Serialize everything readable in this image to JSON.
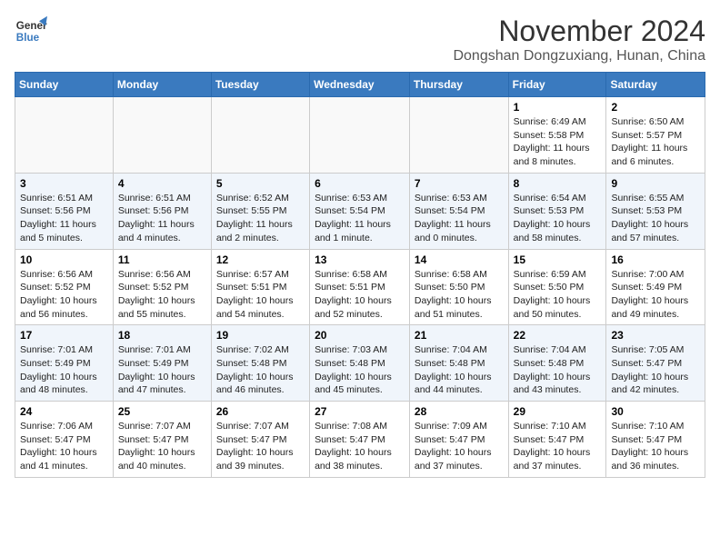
{
  "header": {
    "logo_line1": "General",
    "logo_line2": "Blue",
    "month": "November 2024",
    "location": "Dongshan Dongzuxiang, Hunan, China"
  },
  "weekdays": [
    "Sunday",
    "Monday",
    "Tuesday",
    "Wednesday",
    "Thursday",
    "Friday",
    "Saturday"
  ],
  "weeks": [
    [
      {
        "day": "",
        "info": ""
      },
      {
        "day": "",
        "info": ""
      },
      {
        "day": "",
        "info": ""
      },
      {
        "day": "",
        "info": ""
      },
      {
        "day": "",
        "info": ""
      },
      {
        "day": "1",
        "info": "Sunrise: 6:49 AM\nSunset: 5:58 PM\nDaylight: 11 hours and 8 minutes."
      },
      {
        "day": "2",
        "info": "Sunrise: 6:50 AM\nSunset: 5:57 PM\nDaylight: 11 hours and 6 minutes."
      }
    ],
    [
      {
        "day": "3",
        "info": "Sunrise: 6:51 AM\nSunset: 5:56 PM\nDaylight: 11 hours and 5 minutes."
      },
      {
        "day": "4",
        "info": "Sunrise: 6:51 AM\nSunset: 5:56 PM\nDaylight: 11 hours and 4 minutes."
      },
      {
        "day": "5",
        "info": "Sunrise: 6:52 AM\nSunset: 5:55 PM\nDaylight: 11 hours and 2 minutes."
      },
      {
        "day": "6",
        "info": "Sunrise: 6:53 AM\nSunset: 5:54 PM\nDaylight: 11 hours and 1 minute."
      },
      {
        "day": "7",
        "info": "Sunrise: 6:53 AM\nSunset: 5:54 PM\nDaylight: 11 hours and 0 minutes."
      },
      {
        "day": "8",
        "info": "Sunrise: 6:54 AM\nSunset: 5:53 PM\nDaylight: 10 hours and 58 minutes."
      },
      {
        "day": "9",
        "info": "Sunrise: 6:55 AM\nSunset: 5:53 PM\nDaylight: 10 hours and 57 minutes."
      }
    ],
    [
      {
        "day": "10",
        "info": "Sunrise: 6:56 AM\nSunset: 5:52 PM\nDaylight: 10 hours and 56 minutes."
      },
      {
        "day": "11",
        "info": "Sunrise: 6:56 AM\nSunset: 5:52 PM\nDaylight: 10 hours and 55 minutes."
      },
      {
        "day": "12",
        "info": "Sunrise: 6:57 AM\nSunset: 5:51 PM\nDaylight: 10 hours and 54 minutes."
      },
      {
        "day": "13",
        "info": "Sunrise: 6:58 AM\nSunset: 5:51 PM\nDaylight: 10 hours and 52 minutes."
      },
      {
        "day": "14",
        "info": "Sunrise: 6:58 AM\nSunset: 5:50 PM\nDaylight: 10 hours and 51 minutes."
      },
      {
        "day": "15",
        "info": "Sunrise: 6:59 AM\nSunset: 5:50 PM\nDaylight: 10 hours and 50 minutes."
      },
      {
        "day": "16",
        "info": "Sunrise: 7:00 AM\nSunset: 5:49 PM\nDaylight: 10 hours and 49 minutes."
      }
    ],
    [
      {
        "day": "17",
        "info": "Sunrise: 7:01 AM\nSunset: 5:49 PM\nDaylight: 10 hours and 48 minutes."
      },
      {
        "day": "18",
        "info": "Sunrise: 7:01 AM\nSunset: 5:49 PM\nDaylight: 10 hours and 47 minutes."
      },
      {
        "day": "19",
        "info": "Sunrise: 7:02 AM\nSunset: 5:48 PM\nDaylight: 10 hours and 46 minutes."
      },
      {
        "day": "20",
        "info": "Sunrise: 7:03 AM\nSunset: 5:48 PM\nDaylight: 10 hours and 45 minutes."
      },
      {
        "day": "21",
        "info": "Sunrise: 7:04 AM\nSunset: 5:48 PM\nDaylight: 10 hours and 44 minutes."
      },
      {
        "day": "22",
        "info": "Sunrise: 7:04 AM\nSunset: 5:48 PM\nDaylight: 10 hours and 43 minutes."
      },
      {
        "day": "23",
        "info": "Sunrise: 7:05 AM\nSunset: 5:47 PM\nDaylight: 10 hours and 42 minutes."
      }
    ],
    [
      {
        "day": "24",
        "info": "Sunrise: 7:06 AM\nSunset: 5:47 PM\nDaylight: 10 hours and 41 minutes."
      },
      {
        "day": "25",
        "info": "Sunrise: 7:07 AM\nSunset: 5:47 PM\nDaylight: 10 hours and 40 minutes."
      },
      {
        "day": "26",
        "info": "Sunrise: 7:07 AM\nSunset: 5:47 PM\nDaylight: 10 hours and 39 minutes."
      },
      {
        "day": "27",
        "info": "Sunrise: 7:08 AM\nSunset: 5:47 PM\nDaylight: 10 hours and 38 minutes."
      },
      {
        "day": "28",
        "info": "Sunrise: 7:09 AM\nSunset: 5:47 PM\nDaylight: 10 hours and 37 minutes."
      },
      {
        "day": "29",
        "info": "Sunrise: 7:10 AM\nSunset: 5:47 PM\nDaylight: 10 hours and 37 minutes."
      },
      {
        "day": "30",
        "info": "Sunrise: 7:10 AM\nSunset: 5:47 PM\nDaylight: 10 hours and 36 minutes."
      }
    ]
  ]
}
